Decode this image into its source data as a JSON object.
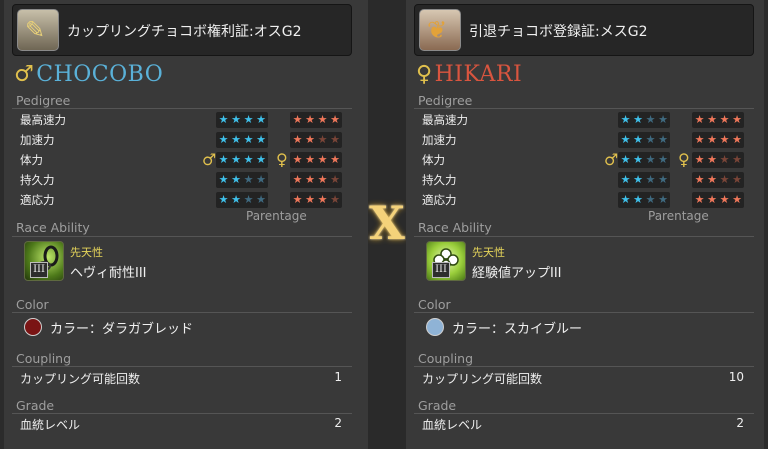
{
  "cross": "X",
  "left": {
    "item_name": "カップリングチョコボ権利証:オスG2",
    "item_icon": "certificate-chocobo-feather-icon",
    "chocobo_name": "CHOCOBO",
    "sex_symbol": "♂",
    "name_color": "#5ab1d8",
    "pedigree_title": "Pedigree",
    "stats": [
      {
        "label": "最高速力",
        "sire": 4,
        "dam": 4
      },
      {
        "label": "加速力",
        "sire": 4,
        "dam": 2
      },
      {
        "label": "体力",
        "sire": 4,
        "dam": 4
      },
      {
        "label": "持久力",
        "sire": 2,
        "dam": 3
      },
      {
        "label": "適応力",
        "sire": 2,
        "dam": 3
      }
    ],
    "parentage_label": "Parentage",
    "race_ability_title": "Race Ability",
    "ability_type": "先天性",
    "ability_name": "ヘヴィ耐性III",
    "ability_badge": "III",
    "ability_icon": "heavy-resistance-chain-icon",
    "color_title": "Color",
    "color_name": "カラー：ダラガブレッド",
    "color_hex": "#7a1414",
    "coupling_title": "Coupling",
    "coupling_label": "カップリング可能回数",
    "coupling_value": "1",
    "grade_title": "Grade",
    "grade_label": "血統レベル",
    "grade_value": "2"
  },
  "right": {
    "item_name": "引退チョコボ登録証:メスG2",
    "item_icon": "certificate-chocobo-retired-icon",
    "chocobo_name": "HIKARI",
    "sex_symbol": "♀",
    "name_color": "#d9553f",
    "pedigree_title": "Pedigree",
    "stats": [
      {
        "label": "最高速力",
        "sire": 2,
        "dam": 4
      },
      {
        "label": "加速力",
        "sire": 2,
        "dam": 4
      },
      {
        "label": "体力",
        "sire": 2,
        "dam": 2
      },
      {
        "label": "持久力",
        "sire": 2,
        "dam": 2
      },
      {
        "label": "適応力",
        "sire": 2,
        "dam": 4
      }
    ],
    "parentage_label": "Parentage",
    "race_ability_title": "Race Ability",
    "ability_type": "先天性",
    "ability_name": "経験値アップIII",
    "ability_badge": "III",
    "ability_icon": "experience-up-clover-icon",
    "color_title": "Color",
    "color_name": "カラー：スカイブルー",
    "color_hex": "#8fb3d6",
    "coupling_title": "Coupling",
    "coupling_label": "カップリング可能回数",
    "coupling_value": "10",
    "grade_title": "Grade",
    "grade_label": "血統レベル",
    "grade_value": "2"
  },
  "colors": {
    "sire_star_on": "#3fc0ea",
    "sire_star_off": "#3f6a80",
    "dam_star_on": "#f0775a",
    "dam_star_off": "#7a4538",
    "sex_icon": "#e0c04d"
  }
}
